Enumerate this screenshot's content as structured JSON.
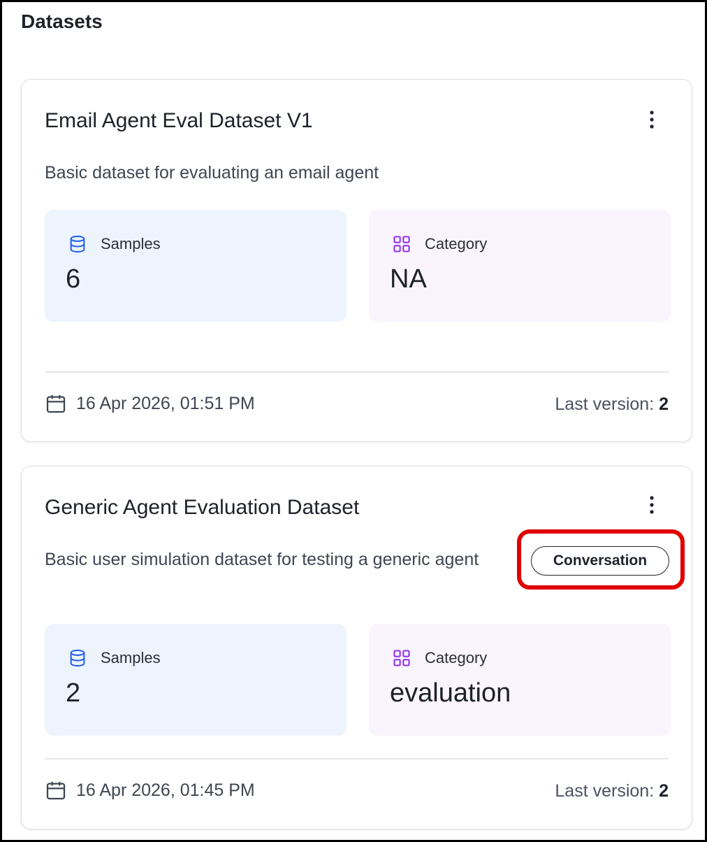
{
  "page": {
    "title": "Datasets"
  },
  "datasets": [
    {
      "name": "Email Agent Eval Dataset V1",
      "description": "Basic dataset for evaluating an email agent",
      "samples_label": "Samples",
      "samples_value": "6",
      "category_label": "Category",
      "category_value": "NA",
      "date": "16 Apr 2026, 01:51 PM",
      "last_version_label": "Last version:",
      "last_version": "2"
    },
    {
      "name": "Generic Agent Evaluation Dataset",
      "description": "Basic user simulation dataset for testing a generic agent",
      "tag": "Conversation",
      "samples_label": "Samples",
      "samples_value": "2",
      "category_label": "Category",
      "category_value": "evaluation",
      "date": "16 Apr 2026, 01:45 PM",
      "last_version_label": "Last version:",
      "last_version": "2"
    }
  ],
  "icons": {
    "samples": "database-icon",
    "category": "grid-icon",
    "date": "calendar-icon",
    "menu": "kebab-menu-icon"
  },
  "colors": {
    "samples_icon": "#2563eb",
    "category_icon": "#9333ea",
    "samples_tile_bg": "#eef4fd",
    "category_tile_bg": "#f9f4fe",
    "highlight": "#e00000"
  }
}
